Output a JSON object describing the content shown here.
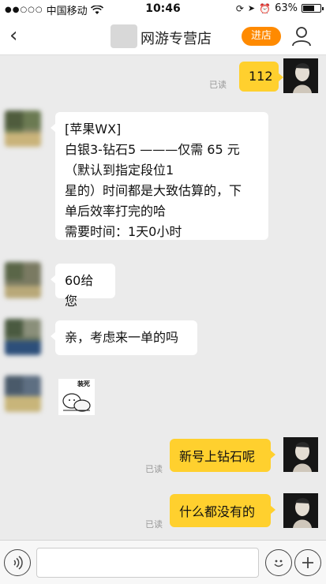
{
  "status_bar": {
    "carrier": "中国移动",
    "time": "10:46",
    "battery": "63%"
  },
  "nav": {
    "title": "网游专营店",
    "enter_shop": "进店"
  },
  "messages": [
    {
      "from": "me",
      "text": "112",
      "read": "已读"
    },
    {
      "from": "them",
      "lines": [
        "[苹果WX]",
        "白银3-钻石5 ———仅需 65 元",
        "（默认到指定段位1",
        "星的）时间都是大致估算的，下",
        "单后效率打完的哈",
        "需要时间：1天0小时"
      ]
    },
    {
      "from": "them",
      "text": "60给您"
    },
    {
      "from": "them",
      "text": "亲，考虑来一单的吗"
    },
    {
      "from": "them",
      "sticker_caption": "装死"
    },
    {
      "from": "me",
      "text": "新号上钻石呢",
      "read": "已读"
    },
    {
      "from": "me",
      "text": "什么都没有的",
      "read": "已读"
    }
  ],
  "input": {
    "placeholder": ""
  },
  "colors": {
    "accent": "#ff8a00",
    "my_bubble": "#ffd02e",
    "background": "#ebebeb"
  },
  "icons": [
    "back-icon",
    "user-icon",
    "voice-icon",
    "emoji-icon",
    "plus-icon",
    "wifi-icon",
    "location-icon",
    "alarm-icon"
  ]
}
